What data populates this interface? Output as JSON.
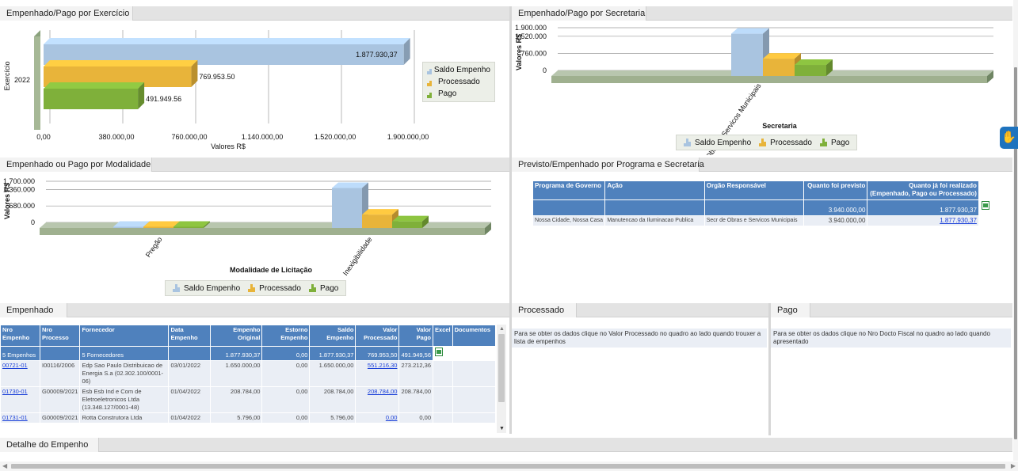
{
  "panels": {
    "exercicio": {
      "tab": "Empenhado/Pago por Exercício"
    },
    "secretaria": {
      "tab": "Empenhado/Pago por Secretaria"
    },
    "modalidade": {
      "tab": "Empenhado ou Pago por Modalidade"
    },
    "programa": {
      "tab": "Previsto/Empenhado por Programa e Secretaria"
    },
    "empenhado": {
      "tab": "Empenhado"
    },
    "processado": {
      "tab": "Processado",
      "hint": "Para se obter os dados clique no Valor Processado no quadro ao lado quando trouxer a lista de empenhos"
    },
    "pago": {
      "tab": "Pago",
      "hint": "Para se obter os dados clique no Nro Docto Fiscal no quadro ao lado quando apresentado"
    },
    "detalhe": {
      "tab": "Detalhe do Empenho"
    }
  },
  "legend": {
    "saldo": "Saldo Empenho",
    "processado": "Processado",
    "pago": "Pago"
  },
  "colors": {
    "saldo": "#a9c4e0",
    "processado": "#e8b43a",
    "pago": "#7fb03a",
    "header": "#4f81bd",
    "link": "#1a3fd8"
  },
  "chart_data": [
    {
      "type": "bar",
      "orientation": "horizontal",
      "categories": [
        "2022"
      ],
      "series": [
        {
          "name": "Saldo Empenho",
          "values": [
            1877930.37
          ]
        },
        {
          "name": "Processado",
          "values": [
            769953.5
          ]
        },
        {
          "name": "Pago",
          "values": [
            491949.56
          ]
        }
      ],
      "data_labels": [
        "1.877.930,37",
        "769.953.50",
        "491.949.56"
      ],
      "xlabel": "Valores R$",
      "ylabel": "Exercício",
      "xticks": [
        "0,00",
        "380.000,00",
        "760.000,00",
        "1.140.000,00",
        "1.520.000,00",
        "1.900.000,00"
      ],
      "xlim": [
        0,
        1900000
      ],
      "legend": "right"
    },
    {
      "type": "bar",
      "categories": [
        "Secr de Obras e Servicos Municipais"
      ],
      "series": [
        {
          "name": "Saldo Empenho",
          "values": [
            1877930.37
          ]
        },
        {
          "name": "Processado",
          "values": [
            769953.5
          ]
        },
        {
          "name": "Pago",
          "values": [
            491949.56
          ]
        }
      ],
      "xlabel": "Secretaria",
      "ylabel": "Valores R$",
      "yticks": [
        "0",
        "760.000",
        "1.520.000",
        "1.900.000"
      ],
      "ylim": [
        0,
        1900000
      ],
      "legend": "bottom"
    },
    {
      "type": "bar",
      "categories": [
        "Pregão",
        "Inexigibilidade"
      ],
      "series": [
        {
          "name": "Saldo Empenho",
          "values": [
            50000,
            1650000
          ]
        },
        {
          "name": "Processado",
          "values": [
            50000,
            551216.3
          ]
        },
        {
          "name": "Pago",
          "values": [
            50000,
            273212.36
          ]
        }
      ],
      "xlabel": "Modalidade de Licitação",
      "ylabel": "Valores R$",
      "yticks": [
        "0",
        "680.000",
        "1.360.000",
        "1.700.000"
      ],
      "ylim": [
        0,
        1700000
      ],
      "legend": "bottom"
    }
  ],
  "programa_table": {
    "headers": [
      "Programa de Governo",
      "Ação",
      "Orgão Responsável",
      "Quanto foi previsto",
      "Quanto já foi realizado (Empenhado, Pago ou Processado)"
    ],
    "total": {
      "previsto": "3.940.000,00",
      "realizado": "1.877.930,37"
    },
    "row": {
      "programa": "Nossa Cidade, Nossa Casa",
      "acao": "Manutencao da Iluminacao Publica",
      "orgao": "Secr de Obras e Servicos Municipais",
      "previsto": "3.940.000,00",
      "realizado": "1.877.930,37"
    }
  },
  "empenhos_table": {
    "headers": {
      "nro": "Nro Empenho",
      "processo": "Nro Processo",
      "fornecedor": "Fornecedor",
      "data": "Data Empenho",
      "original": "Empenho Original",
      "estorno": "Estorno Empenho",
      "saldo": "Saldo Empenho",
      "processado": "Valor Processado",
      "pago": "Valor Pago",
      "excel": "Excel",
      "docs": "Documentos"
    },
    "summary": {
      "nro": "5 Empenhos",
      "fornecedor": "5 Fornecedores",
      "original": "1.877.930,37",
      "estorno": "0,00",
      "saldo": "1.877.930,37",
      "processado": "769.953,50",
      "pago": "491.949,56"
    },
    "rows": [
      {
        "nro": "00721-01",
        "processo": "I00116/2006",
        "fornecedor": "Edp Sao Paulo Distribuicao de Energia S.a (02.302.100/0001-06)",
        "data": "03/01/2022",
        "original": "1.650.000,00",
        "estorno": "0,00",
        "saldo": "1.650.000,00",
        "processado": "551.216,30",
        "pago": "273.212,36"
      },
      {
        "nro": "01730-01",
        "processo": "G00009/2021",
        "fornecedor": "Esb Esb Ind e Com de Eletroeletronicos Ltda (13.348.127/0001-48)",
        "data": "01/04/2022",
        "original": "208.784,00",
        "estorno": "0,00",
        "saldo": "208.784,00",
        "processado": "208.784,00",
        "pago": "208.784,00"
      },
      {
        "nro": "01731-01",
        "processo": "G00009/2021",
        "fornecedor": "Rotta Construtora Ltda",
        "data": "01/04/2022",
        "original": "5.796,00",
        "estorno": "0,00",
        "saldo": "5.796,00",
        "processado": "0,00",
        "pago": "0,00"
      }
    ]
  }
}
